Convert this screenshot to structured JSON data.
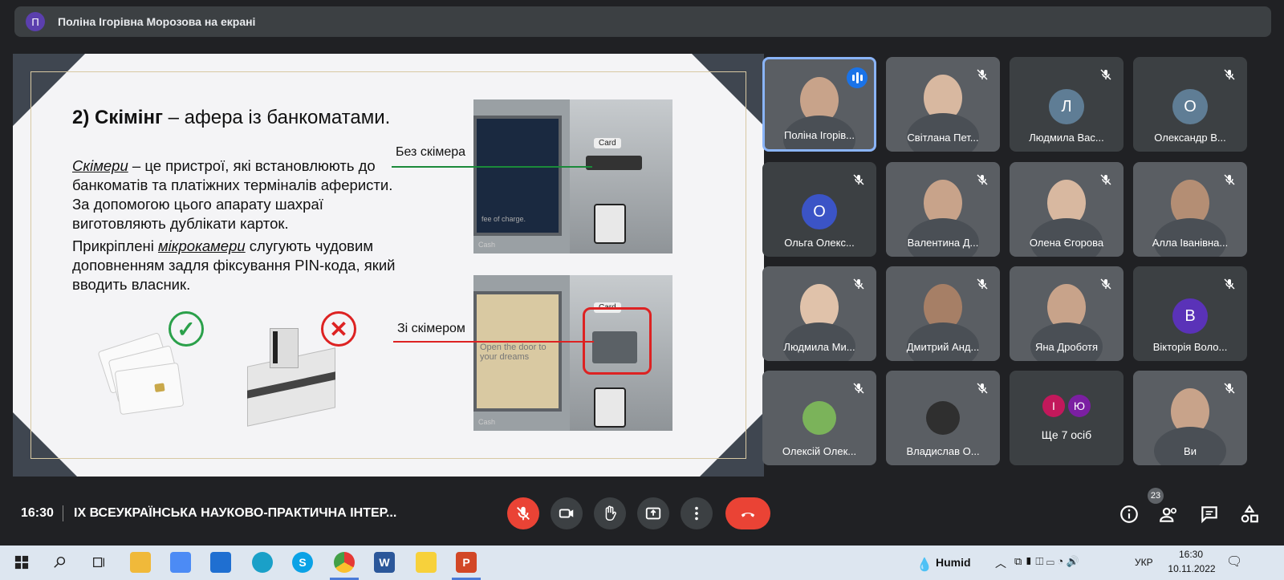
{
  "presenter": {
    "initial": "П",
    "text": "Поліна Ігорівна Морозова на екрані"
  },
  "slide": {
    "title_bold": "2) Скімінг",
    "title_rest": " – афера із банкоматами.",
    "para1_term": "Скімери",
    "para1_rest": " – це пристрої, які встановлюють до банкоматів та платіжних терміналів аферисти. За допомогою цього апарату шахраї виготовляють дублікати карток.",
    "para2_start": "Прикріплені ",
    "para2_term": "мікрокамери",
    "para2_rest": " слугують чудовим доповненням задля фіксування PIN-кода, який вводить власник.",
    "label_without": "Без скімера",
    "label_with": "Зі скімером",
    "atm_card_label": "Card",
    "atm_cash_label": "Cash",
    "atm1_screen_text": "fee of charge.",
    "atm2_screen_text": "Open the door to your dreams"
  },
  "participants": [
    {
      "name": "Поліна Ігорів...",
      "type": "video",
      "active": true
    },
    {
      "name": "Світлана Пет...",
      "type": "video"
    },
    {
      "name": "Людмила Вас...",
      "type": "avatar",
      "initial": "Л",
      "color": "#5f7d95"
    },
    {
      "name": "Олександр В...",
      "type": "avatar",
      "initial": "О",
      "color": "#5f7d95"
    },
    {
      "name": "Ольга Олекс...",
      "type": "avatar",
      "initial": "О",
      "color": "#3b54c6"
    },
    {
      "name": "Валентина Д...",
      "type": "video"
    },
    {
      "name": "Олена Єгорова",
      "type": "video"
    },
    {
      "name": "Алла Іванівна...",
      "type": "video"
    },
    {
      "name": "Людмила Ми...",
      "type": "video"
    },
    {
      "name": "Дмитрий Анд...",
      "type": "video"
    },
    {
      "name": "Яна Дроботя",
      "type": "video"
    },
    {
      "name": "Вікторія Воло...",
      "type": "avatar",
      "initial": "В",
      "color": "#5a32b8"
    },
    {
      "name": "Олексій Олек...",
      "type": "photo"
    },
    {
      "name": "Владислав О...",
      "type": "photo"
    },
    {
      "name": "Ще 7 осіб",
      "type": "more",
      "initials": [
        "І",
        "Ю"
      ],
      "colors": [
        "#c2185b",
        "#7b1fa2"
      ]
    },
    {
      "name": "Ви",
      "type": "video"
    }
  ],
  "meet": {
    "time": "16:30",
    "title": "IX ВСЕУКРАЇНСЬКА НАУКОВО-ПРАКТИЧНА ІНТЕР...",
    "people_count": "23"
  },
  "taskbar": {
    "weather": "Humid",
    "lang": "УКР",
    "time": "16:30",
    "date": "10.11.2022",
    "word_label": "W",
    "skype_label": "S",
    "ppt_label": "P"
  }
}
